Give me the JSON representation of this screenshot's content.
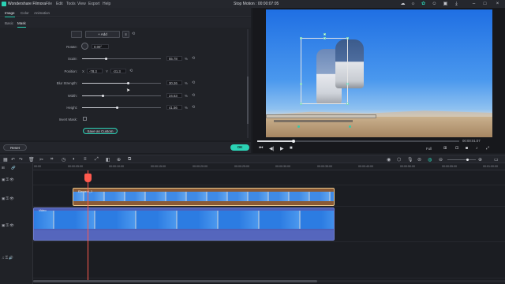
{
  "app": {
    "name": "Wondershare Filmora",
    "menu": [
      "File",
      "Edit",
      "Tools",
      "View",
      "Export",
      "Help"
    ],
    "document_title": "Stop Motion : 00:00:07:05"
  },
  "panel": {
    "main_tabs": [
      {
        "label": "Image",
        "active": true
      },
      {
        "label": "Color",
        "active": false
      },
      {
        "label": "Animation",
        "active": false
      }
    ],
    "sub_tabs": [
      {
        "label": "Basic",
        "active": false
      },
      {
        "label": "Mask",
        "active": true
      }
    ],
    "add_button": "+ Add",
    "rotate": {
      "label": "Rotate:",
      "value": "0.00°"
    },
    "scale": {
      "label": "Scale:",
      "value": "55.78",
      "unit": "%",
      "fraction": 0.5578
    },
    "position": {
      "label": "Position:",
      "x_label": "X",
      "x_value": "-78.3",
      "y_label": "Y",
      "y_value": "-31.3"
    },
    "blur": {
      "label": "Blur Strength:",
      "value": "30.26",
      "unit": "%",
      "fraction": 0.3026
    },
    "width": {
      "label": "Width:",
      "value": "24.53",
      "unit": "%",
      "fraction": 0.2453
    },
    "height": {
      "label": "Height:",
      "value": "41.56",
      "unit": "%",
      "fraction": 0.4156
    },
    "invert": {
      "label": "Invert Mask:",
      "checked": false
    },
    "save_custom": "Save as Custom",
    "reset_label": "Reset",
    "ok_label": "OK"
  },
  "preview": {
    "timecode_end": "00:00:01:07",
    "quality": "Full",
    "progress_fraction": 0.18
  },
  "timeline": {
    "ruler": [
      "00:00",
      "00:00:05:00",
      "00:00:10:00",
      "00:00:15:00",
      "00:00:20:00",
      "00:00:25:00",
      "00:00:30:00",
      "00:00:35:00",
      "00:00:40:00",
      "00:00:45:00",
      "00:00:50:00",
      "00:00:55:00",
      "00:01:00:00",
      "00:01:05:00"
    ],
    "clip_top_name": "Element_1",
    "clip_main_name": "Video"
  },
  "colors": {
    "accent": "#2bd2b5",
    "playhead": "#ff5a4e",
    "clip_green_border": "#e8c58a",
    "clip_blue": "#4e5fb6"
  }
}
